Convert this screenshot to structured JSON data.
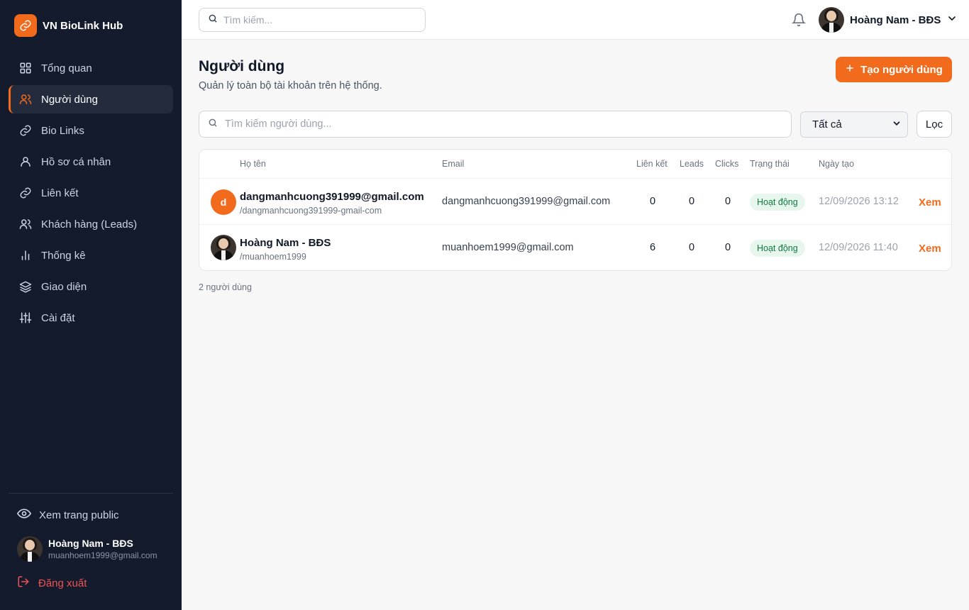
{
  "brand": {
    "name": "VN BioLink Hub"
  },
  "colors": {
    "accent": "#f26b1d",
    "sidebar_bg": "#141b2d",
    "success": "#0f7a3c",
    "danger": "#f05252"
  },
  "sidebar": {
    "items": [
      {
        "label": "Tổng quan",
        "icon": "grid-icon"
      },
      {
        "label": "Người dùng",
        "icon": "users-icon",
        "active": true
      },
      {
        "label": "Bio Links",
        "icon": "link-icon"
      },
      {
        "label": "Hồ sơ cá nhân",
        "icon": "user-icon"
      },
      {
        "label": "Liên kết",
        "icon": "link-icon"
      },
      {
        "label": "Khách hàng (Leads)",
        "icon": "users-icon"
      },
      {
        "label": "Thống kê",
        "icon": "bar-chart-icon"
      },
      {
        "label": "Giao diện",
        "icon": "layers-icon"
      },
      {
        "label": "Cài đặt",
        "icon": "sliders-icon"
      }
    ],
    "public_link": "Xem trang public",
    "user": {
      "name": "Hoàng Nam - BĐS",
      "email": "muanhoem1999@gmail.com"
    },
    "logout": "Đăng xuất"
  },
  "topbar": {
    "search_placeholder": "Tìm kiếm...",
    "user_name": "Hoàng Nam - BĐS"
  },
  "main": {
    "title": "Người dùng",
    "subtitle": "Quản lý toàn bộ tài khoản trên hệ thống.",
    "create_button": "Tạo người dùng",
    "search_placeholder": "Tìm kiếm người dùng...",
    "status_filter": {
      "selected": "Tất cả"
    },
    "filter_button": "Lọc",
    "table": {
      "headers": {
        "name": "Họ tên",
        "email": "Email",
        "links": "Liên kết",
        "leads": "Leads",
        "clicks": "Clicks",
        "status": "Trạng thái",
        "created": "Ngày tạo"
      },
      "rows": [
        {
          "initial": "d",
          "name": "dangmanhcuong391999@gmail.com",
          "slug": "/dangmanhcuong391999-gmail-com",
          "email": "dangmanhcuong391999@gmail.com",
          "links": "0",
          "leads": "0",
          "clicks": "0",
          "status": "Hoạt động",
          "created": "12/09/2026 13:12",
          "action": "Xem"
        },
        {
          "name": "Hoàng Nam - BĐS",
          "slug": "/muanhoem1999",
          "email": "muanhoem1999@gmail.com",
          "links": "6",
          "leads": "0",
          "clicks": "0",
          "status": "Hoạt động",
          "created": "12/09/2026 11:40",
          "action": "Xem"
        }
      ]
    },
    "count_text": "2 người dùng"
  }
}
